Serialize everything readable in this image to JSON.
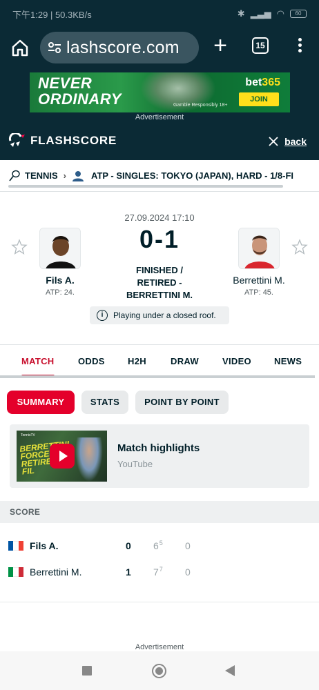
{
  "status_bar": {
    "time": "下午1:29",
    "speed": "50.3KB/s",
    "battery": "60"
  },
  "browser": {
    "url": "lashscore.com",
    "tab_count": "15"
  },
  "ad_top": {
    "headline_line1": "NEVER",
    "headline_line2": "ORDINARY",
    "brand_a": "bet",
    "brand_b": "365",
    "cta": "JOIN",
    "gamble_note": "Gamble Responsibly  18+",
    "label": "Advertisement"
  },
  "site_header": {
    "logo_text": "FLASHSCORE",
    "back_label": "back"
  },
  "breadcrumb": {
    "sport": "TENNIS",
    "competition": "ATP - SINGLES: TOKYO (JAPAN), HARD - 1/8-FI"
  },
  "match": {
    "datetime": "27.09.2024 17:10",
    "score": "0-1",
    "status_lines": [
      "FINISHED /",
      "RETIRED -",
      "BERRETTINI M."
    ],
    "home": {
      "name": "Fils A.",
      "rank": "ATP: 24."
    },
    "away": {
      "name": "Berrettini M.",
      "rank": "ATP: 45."
    },
    "info": "Playing under a closed roof."
  },
  "tabs": [
    "MATCH",
    "ODDS",
    "H2H",
    "DRAW",
    "VIDEO",
    "NEWS"
  ],
  "active_tab": "MATCH",
  "subtabs": [
    "SUMMARY",
    "STATS",
    "POINT BY POINT"
  ],
  "active_subtab": "SUMMARY",
  "highlight": {
    "title": "Match highlights",
    "source": "YouTube",
    "thumb_brand": "TennisTV",
    "thumb_text": [
      "BERRETTINI",
      "FORCES",
      "RETIRE",
      "FIL"
    ]
  },
  "score_section": {
    "header": "SCORE",
    "rows": [
      {
        "name": "Fils A.",
        "total": "0",
        "set1": "6",
        "set1_tb": "5",
        "set2": "0",
        "flag": [
          "#0055a4",
          "#ffffff",
          "#ef4135"
        ]
      },
      {
        "name": "Berrettini M.",
        "total": "1",
        "set1": "7",
        "set1_tb": "7",
        "set2": "0",
        "flag": [
          "#009246",
          "#ffffff",
          "#ce2b37"
        ]
      }
    ]
  },
  "ad_bottom_label": "Advertisement",
  "colors": {
    "accent": "#e4002b",
    "header_bg": "#0b2a35"
  }
}
